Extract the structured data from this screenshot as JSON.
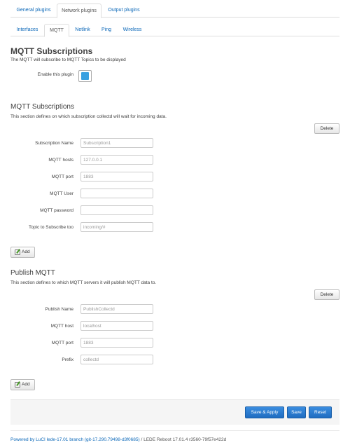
{
  "top_tabs": [
    {
      "label": "General plugins",
      "active": false
    },
    {
      "label": "Network plugins",
      "active": true
    },
    {
      "label": "Output plugins",
      "active": false
    }
  ],
  "sub_tabs": [
    {
      "label": "Interfaces",
      "active": false
    },
    {
      "label": "MQTT",
      "active": true
    },
    {
      "label": "Netlink",
      "active": false
    },
    {
      "label": "Ping",
      "active": false
    },
    {
      "label": "Wireless",
      "active": false
    }
  ],
  "page": {
    "title": "MQTT Subscriptions",
    "description": "The MQTT will subscribe to MQTT Topics to be displayed",
    "enable_label": "Enable this plugin",
    "enabled": true
  },
  "subscriptions": {
    "title": "MQTT Subscriptions",
    "description": "This section defines on which subscription collectd will wait for incoming data.",
    "delete_label": "Delete",
    "add_label": "Add",
    "fields": [
      {
        "label": "Subscription Name",
        "value": "Subscription1"
      },
      {
        "label": "MQTT hosts",
        "value": "127.0.0.1"
      },
      {
        "label": "MQTT port",
        "value": "1883"
      },
      {
        "label": "MQTT User",
        "value": ""
      },
      {
        "label": "MQTT password",
        "value": ""
      },
      {
        "label": "Topic to Subscribe too",
        "value": "incoming/#"
      }
    ]
  },
  "publish": {
    "title": "Publish MQTT",
    "description": "This section defines to which MQTT servers it will publish MQTT data to.",
    "delete_label": "Delete",
    "add_label": "Add",
    "fields": [
      {
        "label": "Publish Name",
        "value": "PublishCollectd"
      },
      {
        "label": "MQTT host",
        "value": "localhost"
      },
      {
        "label": "MQTT port",
        "value": "1883"
      },
      {
        "label": "Prefix",
        "value": "collectd"
      }
    ]
  },
  "actions": {
    "save_apply": "Save & Apply",
    "save": "Save",
    "reset": "Reset"
  },
  "footer": {
    "link_text": "Powered by LuCI lede-17.01 branch (git-17.290.79498-d3f0685)",
    "version_text": " / LEDE Reboot 17.01.4 r3560-79f57e422d"
  },
  "colors": {
    "link": "#0a67b8",
    "primary_button": "#1f6cc0",
    "checkbox_checked": "#3aa0e0"
  }
}
